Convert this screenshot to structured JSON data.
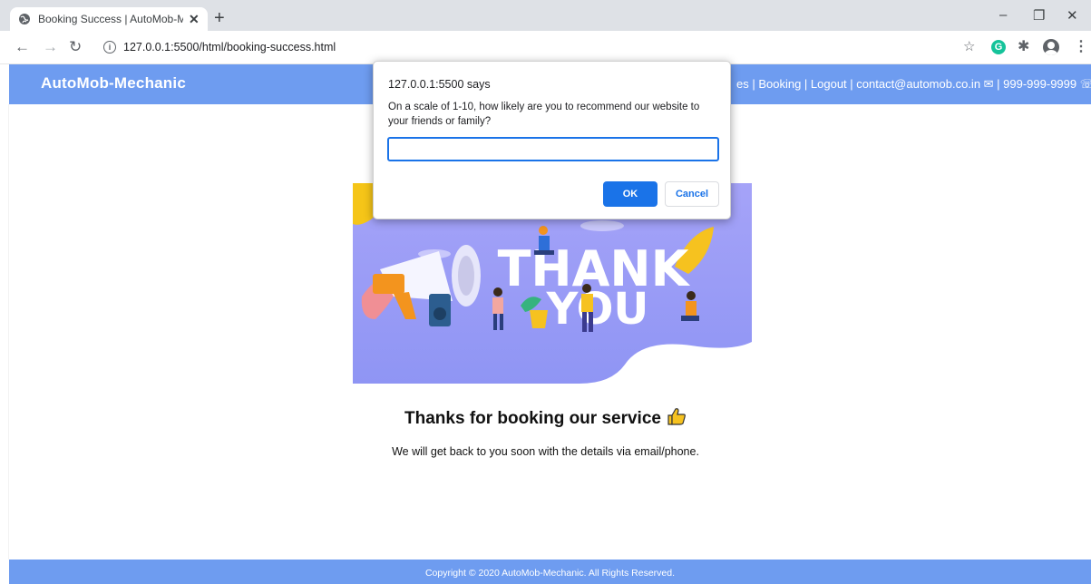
{
  "browser": {
    "tab_title": "Booking Success | AutoMob-Mec",
    "url": "127.0.0.1:5500/html/booking-success.html",
    "new_tab_label": "+",
    "close_tab_label": "✕"
  },
  "site": {
    "brand": "AutoMob-Mechanic",
    "nav_text": "es | Booking | Logout | contact@automob.co.in ✉ | 999-999-9999 ☏",
    "colors": {
      "navbar": "#6e9cf0",
      "illustration_bg": "#9b9cf7"
    }
  },
  "main": {
    "illustration": {
      "word1": "THANK",
      "word2": "YOU"
    },
    "heading": "Thanks for booking our service",
    "subtext": "We will get back to you soon with the details via email/phone."
  },
  "footer": {
    "copyright": "Copyright © 2020 AutoMob-Mechanic.  All Rights Reserved."
  },
  "dialog": {
    "title": "127.0.0.1:5500 says",
    "message": "On a scale of 1-10, how likely are you to recommend our website to your friends or family?",
    "input_value": "",
    "ok_label": "OK",
    "cancel_label": "Cancel"
  }
}
